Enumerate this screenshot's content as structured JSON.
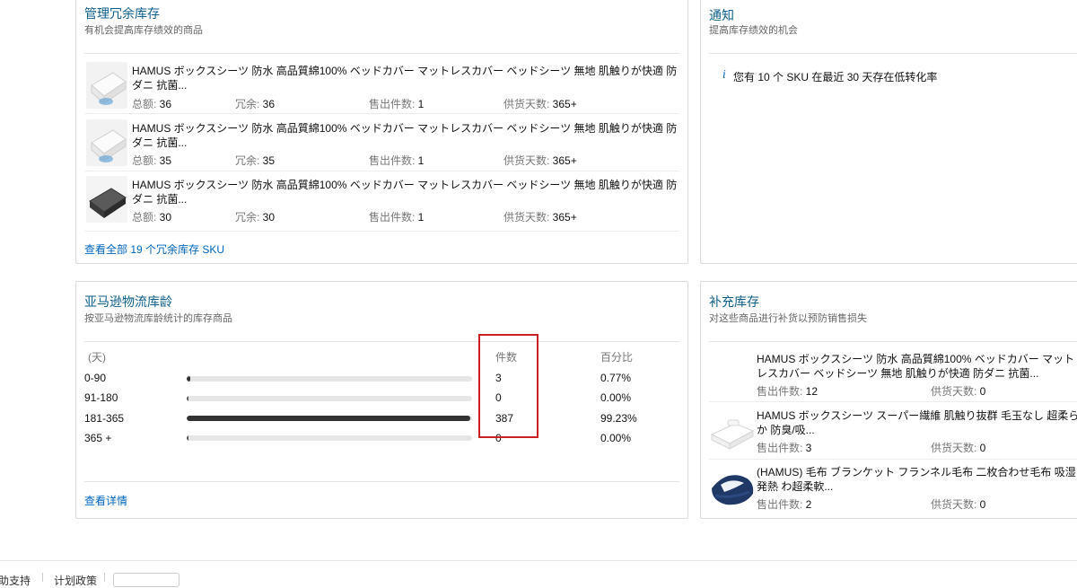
{
  "excess": {
    "title": "管理冗余库存",
    "subtitle": "有机会提高库存绩效的商品",
    "labels": {
      "total": "总额: ",
      "excess": "冗余: ",
      "sold": "售出件数: ",
      "supply": "供货天数: "
    },
    "items": [
      {
        "title": "HAMUS ボックスシーツ 防水 高品質綿100% ベッドカバー マットレスカバー ベッドシーツ 無地 肌触りが快適 防ダニ 抗菌...",
        "total": "36",
        "excess": "36",
        "sold": "1",
        "supply": "365+"
      },
      {
        "title": "HAMUS ボックスシーツ 防水 高品質綿100% ベッドカバー マットレスカバー ベッドシーツ 無地 肌触りが快適 防ダニ 抗菌...",
        "total": "35",
        "excess": "35",
        "sold": "1",
        "supply": "365+"
      },
      {
        "title": "HAMUS ボックスシーツ 防水 高品質綿100% ベッドカバー マットレスカバー ベッドシーツ 無地 肌触りが快適 防ダニ 抗菌...",
        "total": "30",
        "excess": "30",
        "sold": "1",
        "supply": "365+"
      }
    ],
    "view_all": "查看全部 19 个冗余库存 SKU"
  },
  "notice": {
    "title": "通知",
    "subtitle": "提高库存绩效的机会",
    "message": "您有 10 个 SKU 在最近 30 天存在低转化率"
  },
  "aging": {
    "title": "亚马逊物流库龄",
    "subtitle": "按亚马逊物流库龄统计的库存商品",
    "col_days": "(天)",
    "col_units": "件数",
    "col_percent": "百分比",
    "rows": [
      {
        "range": "0-90",
        "units": "3",
        "percent": "0.77%",
        "fraction": 0.0077
      },
      {
        "range": "91-180",
        "units": "0",
        "percent": "0.00%",
        "fraction": 0
      },
      {
        "range": "181-365",
        "units": "387",
        "percent": "99.23%",
        "fraction": 0.9923
      },
      {
        "range": "365 +",
        "units": "0",
        "percent": "0.00%",
        "fraction": 0
      }
    ],
    "details_link": "查看详情"
  },
  "restock": {
    "title": "补充库存",
    "subtitle": "对这些商品进行补货以预防销售损失",
    "labels": {
      "sold": "售出件数: ",
      "supply": "供货天数: "
    },
    "items": [
      {
        "title": "HAMUS ボックスシーツ 防水 高品質綿100% ベッドカバー マットレスカバー ベッドシーツ 無地 肌触りが快適 防ダニ 抗菌...",
        "sold": "12",
        "supply": "0"
      },
      {
        "title": "HAMUS ボックスシーツ スーパー繊維 肌触り抜群 毛玉なし 超柔らか 防臭/吸...",
        "sold": "3",
        "supply": "0"
      },
      {
        "title": "(HAMUS) 毛布 ブランケット フランネル毛布 二枚合わせ毛布 吸湿発熱 わ超柔軟...",
        "sold": "2",
        "supply": "0"
      }
    ]
  },
  "footer": {
    "item1": "帮助支持",
    "item2": "计划政策"
  }
}
